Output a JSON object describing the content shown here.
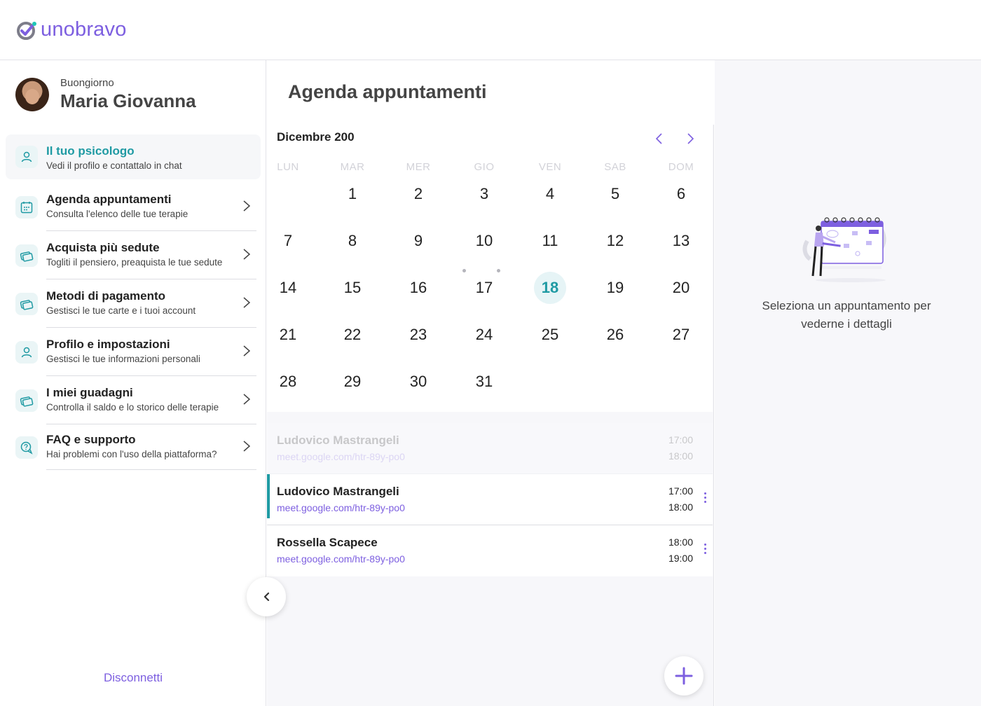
{
  "brand": {
    "name": "unobravo",
    "color": "#7d5fe0",
    "accent": "#1f9aa3"
  },
  "sidebar": {
    "greeting": "Buongiorno",
    "user_name": "Maria Giovanna",
    "items": [
      {
        "title": "Il tuo psicologo",
        "subtitle": "Vedi il profilo e contattalo in chat",
        "icon": "person-icon",
        "active": true
      },
      {
        "title": "Agenda appuntamenti",
        "subtitle": "Consulta l'elenco delle tue terapie",
        "icon": "calendar-icon"
      },
      {
        "title": "Acquista più sedute",
        "subtitle": "Togliti il pensiero, preaquista le tue sedute",
        "icon": "cards-icon"
      },
      {
        "title": "Metodi di pagamento",
        "subtitle": "Gestisci le tue carte e i tuoi account",
        "icon": "cards-icon"
      },
      {
        "title": "Profilo e impostazioni",
        "subtitle": "Gestisci le tue informazioni personali",
        "icon": "person-icon"
      },
      {
        "title": "I miei guadagni",
        "subtitle": "Controlla il saldo e lo storico delle terapie",
        "icon": "cards-icon"
      },
      {
        "title": "FAQ e supporto",
        "subtitle": "Hai problemi con l'uso della piattaforma?",
        "icon": "support-icon"
      }
    ],
    "logout_label": "Disconnetti"
  },
  "agenda": {
    "title": "Agenda appuntamenti",
    "month_label": "Dicembre 200",
    "weekdays": [
      "LUN",
      "MAR",
      "MER",
      "GIO",
      "VEN",
      "SAB",
      "DOM"
    ],
    "days": [
      [
        "",
        "1",
        "2",
        "3",
        "4",
        "5",
        "6"
      ],
      [
        "7",
        "8",
        "9",
        "10",
        "11",
        "12",
        "13"
      ],
      [
        "14",
        "15",
        "16",
        "17",
        "18",
        "19",
        "20"
      ],
      [
        "21",
        "22",
        "23",
        "24",
        "25",
        "26",
        "27"
      ],
      [
        "28",
        "29",
        "30",
        "31",
        "",
        "",
        ""
      ]
    ],
    "today": "18",
    "appointments": [
      {
        "name": "Ludovico Mastrangeli",
        "link": "meet.google.com/htr-89y-po0",
        "start": "17:00",
        "end": "18:00",
        "faded": true
      },
      {
        "name": "Ludovico Mastrangeli",
        "link": "meet.google.com/htr-89y-po0",
        "start": "17:00",
        "end": "18:00",
        "selected": true
      },
      {
        "name": "Rossella Scapece",
        "link": "meet.google.com/htr-89y-po0",
        "start": "18:00",
        "end": "19:00"
      }
    ]
  },
  "detail": {
    "empty_message": "Seleziona un appuntamento per vederne i dettagli"
  }
}
